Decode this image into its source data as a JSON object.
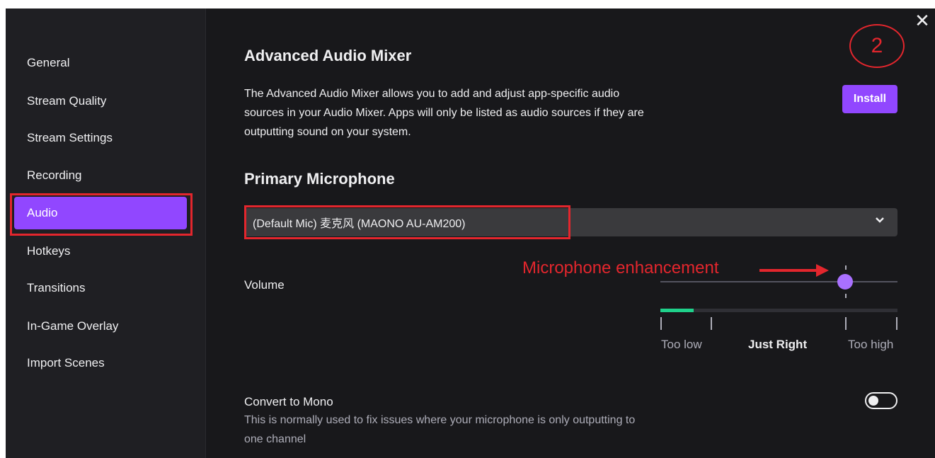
{
  "window": {
    "close_icon": "close-icon"
  },
  "sidebar": {
    "items": [
      {
        "label": "General"
      },
      {
        "label": "Stream Quality"
      },
      {
        "label": "Stream Settings"
      },
      {
        "label": "Recording"
      },
      {
        "label": "Audio",
        "active": true
      },
      {
        "label": "Hotkeys"
      },
      {
        "label": "Transitions"
      },
      {
        "label": "In-Game Overlay"
      },
      {
        "label": "Import Scenes"
      }
    ]
  },
  "advanced_mixer": {
    "title": "Advanced Audio Mixer",
    "description": "The Advanced Audio Mixer allows you to add and adjust app-specific audio sources in your Audio Mixer. Apps will only be listed as audio sources if they are outputting sound on your system.",
    "install_label": "Install"
  },
  "primary_mic": {
    "title": "Primary Microphone",
    "selected_device": "(Default Mic) 麦克风 (MAONO AU-AM200)",
    "dropdown_icon": "chevron-down-icon"
  },
  "volume": {
    "label": "Volume",
    "slider_value_fraction": 0.77,
    "meter_level_fraction": 0.14,
    "meter_labels": {
      "low": "Too low",
      "mid": "Just Right",
      "high": "Too high"
    }
  },
  "mono": {
    "title": "Convert to Mono",
    "description": "This is normally used to fix issues where your microphone is only outputting to one channel",
    "enabled": false
  },
  "annotations": {
    "step_number": "2",
    "arrow_text": "Microphone enhancement",
    "color": "#e3262d"
  },
  "colors": {
    "accent": "#9147ff",
    "slider_thumb": "#a970ff",
    "meter_fill": "#1fd18b",
    "background": "#18181b",
    "sidebar": "#1f1f23"
  }
}
